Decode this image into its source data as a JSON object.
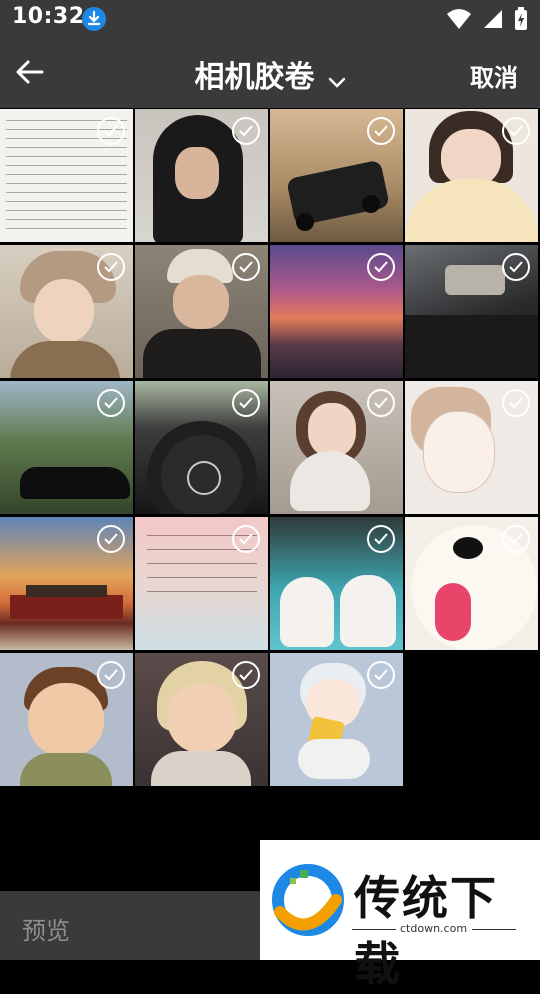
{
  "status": {
    "time": "10:32"
  },
  "header": {
    "title": "相机胶卷",
    "cancel_label": "取消"
  },
  "photos": [
    {
      "desc": "text-document",
      "selected": true
    },
    {
      "desc": "hoodie-person",
      "selected": true
    },
    {
      "desc": "suv-desert",
      "selected": true
    },
    {
      "desc": "girl-pillow",
      "selected": true
    },
    {
      "desc": "girl-hat",
      "selected": true
    },
    {
      "desc": "boy-beanie",
      "selected": true
    },
    {
      "desc": "sunset-sea",
      "selected": true
    },
    {
      "desc": "car-door",
      "selected": true
    },
    {
      "desc": "black-car-trees",
      "selected": true
    },
    {
      "desc": "steering-wheel",
      "selected": true
    },
    {
      "desc": "girl-cat",
      "selected": true
    },
    {
      "desc": "anime-sketch",
      "selected": true
    },
    {
      "desc": "palace-sunset",
      "selected": true
    },
    {
      "desc": "handwritten-note",
      "selected": true
    },
    {
      "desc": "two-cats",
      "selected": true
    },
    {
      "desc": "white-dog",
      "selected": true
    },
    {
      "desc": "cartoon-boy",
      "selected": true
    },
    {
      "desc": "cartoon-girl",
      "selected": true
    },
    {
      "desc": "chibi-character",
      "selected": true
    }
  ],
  "bottom": {
    "preview_label": "预览"
  },
  "watermark": {
    "brand": "传统下载",
    "url": "ctdown.com"
  }
}
